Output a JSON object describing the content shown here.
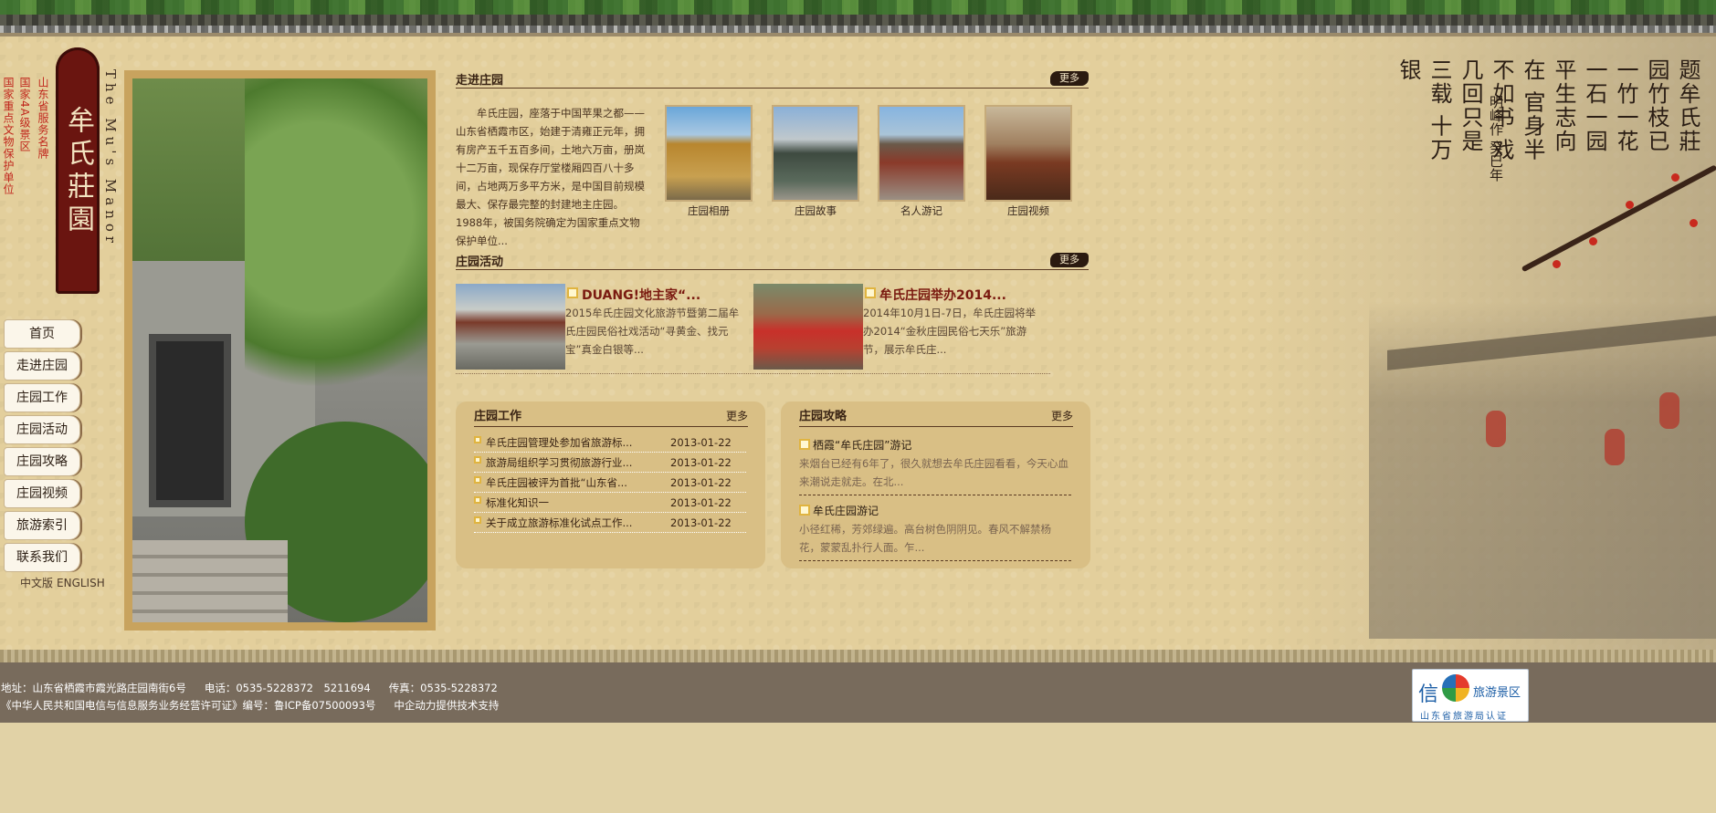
{
  "header": {
    "logo_text": "牟氏莊園",
    "logo_en": "The Mu's Manor",
    "honor_1": "国家重点文物保护单位",
    "honor_2": "国家4A级景区",
    "honor_3": "山东省服务名牌"
  },
  "calligraphy": {
    "main": "题牟氏莊园竹枝已 一竹一花一石一园 平生志向在 官身半不如书 戏几回只是三载 十万银",
    "sign": "明峰作 癸巳年"
  },
  "nav": {
    "items": [
      "首页",
      "走进庄园",
      "庄园工作",
      "庄园活动",
      "庄园攻略",
      "庄园视频",
      "旅游索引",
      "联系我们"
    ],
    "lang_cn": "中文版",
    "lang_en": "ENGLISH"
  },
  "intro": {
    "title": "走进庄园",
    "more": "更多",
    "text": "牟氏庄园，座落于中国苹果之都——山东省栖霞市区，始建于清雍正元年，拥有房产五千五百多间，土地六万亩，册岚十二万亩，现保存厅堂楼厢四百八十多间，占地两万多平方米，是中国目前规模最大、保存最完整的封建地主庄园。1988年，被国务院确定为国家重点文物保护单位...",
    "thumbs": [
      "庄园相册",
      "庄园故事",
      "名人游记",
      "庄园视频"
    ]
  },
  "activities": {
    "title": "庄园活动",
    "more": "更多",
    "items": [
      {
        "title": "DUANG!地主家“...",
        "desc": "2015牟氏庄园文化旅游节暨第二届牟氏庄园民俗社戏活动“寻黄金、找元宝”真金白银等..."
      },
      {
        "title": "牟氏庄园举办2014...",
        "desc": "2014年10月1日-7日，牟氏庄园将举办2014“金秋庄园民俗七天乐”旅游节，展示牟氏庄..."
      }
    ]
  },
  "work": {
    "title": "庄园工作",
    "more": "更多",
    "rows": [
      {
        "title": "牟氏庄园管理处参加省旅游标...",
        "date": "2013-01-22"
      },
      {
        "title": "旅游局组织学习贯彻旅游行业...",
        "date": "2013-01-22"
      },
      {
        "title": "牟氏庄园被评为首批“山东省...",
        "date": "2013-01-22"
      },
      {
        "title": "标准化知识一",
        "date": "2013-01-22"
      },
      {
        "title": "关于成立旅游标准化试点工作...",
        "date": "2013-01-22"
      }
    ]
  },
  "guide": {
    "title": "庄园攻略",
    "more": "更多",
    "items": [
      {
        "title": "栖霞“牟氏庄园”游记",
        "desc": "来烟台已经有6年了，很久就想去牟氏庄园看看，今天心血来潮说走就走。在北..."
      },
      {
        "title": "牟氏庄园游记",
        "desc": "小径红稀，芳郊绿遍。高台树色阴阴见。春风不解禁杨花，蒙蒙乱扑行人面。乍..."
      }
    ]
  },
  "footer": {
    "address": "地址：山东省栖霞市霞光路庄园南街6号",
    "phone": "电话：0535-5228372　5211694",
    "fax": "传真：0535-5228372",
    "license": "《中华人民共和国电信与信息服务业务经营许可证》编号：鲁ICP备07500093号",
    "support": "中企动力提供技术支持",
    "badge_xin": "信",
    "badge_tour": "旅游景区",
    "badge_sub": "山东省旅游局认证"
  },
  "colors": {
    "background": "#e3cf9c",
    "accent_red": "#c0261c",
    "logo_dark_red": "#6a1510",
    "panel": "#d9bf85",
    "footer": "#786b5c"
  }
}
